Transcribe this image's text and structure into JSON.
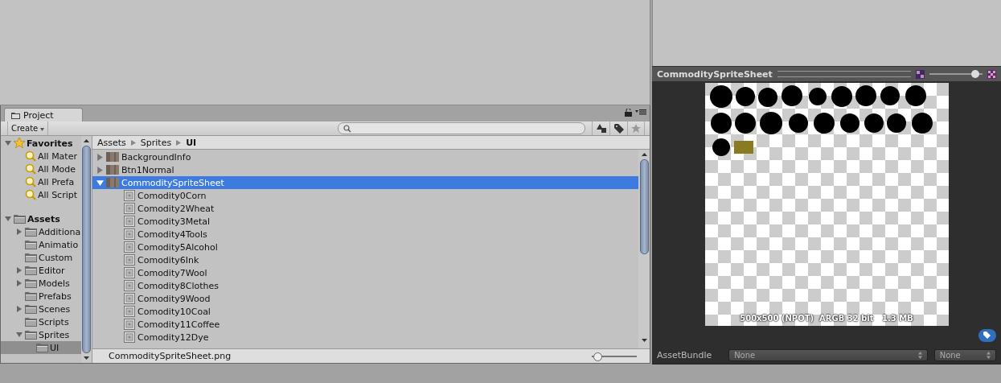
{
  "project_panel": {
    "tab": {
      "label": "Project",
      "selected": true
    },
    "toolbar": {
      "create_button": "Create"
    },
    "sidebar": [
      {
        "label": "Favorites",
        "kind": "favorites",
        "expanded": true,
        "selected": false,
        "children": [
          {
            "label": "All Mater",
            "kind": "search",
            "selected": false
          },
          {
            "label": "All Mode",
            "kind": "search",
            "selected": false
          },
          {
            "label": "All Prefa",
            "kind": "search",
            "selected": false
          },
          {
            "label": "All Script",
            "kind": "search",
            "selected": false
          }
        ]
      },
      {
        "label": "Assets",
        "kind": "folder",
        "expanded": true,
        "selected": false,
        "children": [
          {
            "label": "Additiona",
            "kind": "folder",
            "expanded": false,
            "selected": false
          },
          {
            "label": "Animatio",
            "kind": "folder",
            "selected": false
          },
          {
            "label": "Custom",
            "kind": "folder",
            "selected": false
          },
          {
            "label": "Editor",
            "kind": "folder",
            "expanded": false,
            "selected": false
          },
          {
            "label": "Models",
            "kind": "folder",
            "expanded": false,
            "selected": false
          },
          {
            "label": "Prefabs",
            "kind": "folder",
            "selected": false
          },
          {
            "label": "Scenes",
            "kind": "folder",
            "expanded": false,
            "selected": false
          },
          {
            "label": "Scripts",
            "kind": "folder",
            "selected": false
          },
          {
            "label": "Sprites",
            "kind": "folder",
            "expanded": true,
            "selected": false,
            "children": [
              {
                "label": "UI",
                "kind": "folder",
                "selected": true
              }
            ]
          }
        ]
      }
    ],
    "breadcrumb": [
      {
        "label": "Assets",
        "current": false
      },
      {
        "label": "Sprites",
        "current": false
      },
      {
        "label": "UI",
        "current": true
      }
    ],
    "files": [
      {
        "label": "BackgroundInfo",
        "kind": "texture",
        "expanded": false,
        "selected": false
      },
      {
        "label": "Btn1Normal",
        "kind": "texture",
        "expanded": false,
        "selected": false
      },
      {
        "label": "CommoditySpriteSheet",
        "kind": "texture",
        "expanded": true,
        "selected": true,
        "children": [
          {
            "label": "Comodity0Corn",
            "kind": "sprite",
            "selected": false
          },
          {
            "label": "Comodity2Wheat",
            "kind": "sprite",
            "selected": false
          },
          {
            "label": "Comodity3Metal",
            "kind": "sprite",
            "selected": false
          },
          {
            "label": "Comodity4Tools",
            "kind": "sprite",
            "selected": false
          },
          {
            "label": "Comodity5Alcohol",
            "kind": "sprite",
            "selected": false
          },
          {
            "label": "Comodity6Ink",
            "kind": "sprite",
            "selected": false
          },
          {
            "label": "Comodity7Wool",
            "kind": "sprite",
            "selected": false
          },
          {
            "label": "Comodity8Clothes",
            "kind": "sprite",
            "selected": false
          },
          {
            "label": "Comodity9Wood",
            "kind": "sprite",
            "selected": false
          },
          {
            "label": "Comodity10Coal",
            "kind": "sprite",
            "selected": false
          },
          {
            "label": "Comodity11Coffee",
            "kind": "sprite",
            "selected": false
          },
          {
            "label": "Comodity12Dye",
            "kind": "sprite",
            "selected": false
          }
        ]
      }
    ],
    "footer": {
      "path": "CommoditySpriteSheet.png",
      "zoom_slider": {
        "level": 0.05
      }
    }
  },
  "preview": {
    "title": "CommoditySpriteSheet",
    "zoom_slider": {
      "level": 0.92
    },
    "info": "500x500 (NPOT)  ARGB 32 bit   1.3 MB",
    "asset_bundle": {
      "label": "AssetBundle",
      "name": "None",
      "variant": "None"
    }
  }
}
